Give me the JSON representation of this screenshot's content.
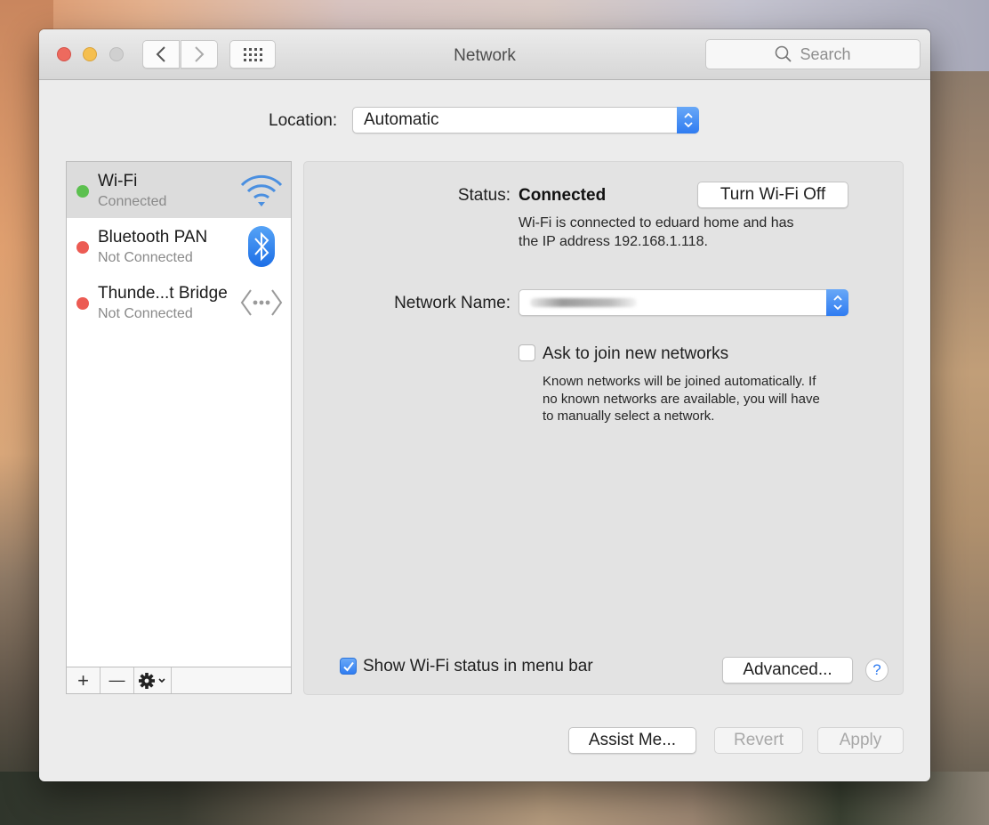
{
  "window": {
    "title": "Network",
    "search": {
      "placeholder": "Search",
      "icon": "magnifier-icon"
    },
    "toolbar": {
      "back_icon": "chevron-left-icon",
      "forward_icon": "chevron-right-icon",
      "show_all_icon": "grid-icon"
    }
  },
  "location": {
    "label": "Location:",
    "value": "Automatic"
  },
  "services": [
    {
      "name": "Wi-Fi",
      "status": "Connected",
      "status_color": "#5cc04f",
      "icon": "wifi-icon",
      "selected": true
    },
    {
      "name": "Bluetooth PAN",
      "status": "Not Connected",
      "status_color": "#ec5b53",
      "icon": "bluetooth-icon",
      "selected": false
    },
    {
      "name": "Thunde...t Bridge",
      "status": "Not Connected",
      "status_color": "#ec5b53",
      "icon": "thunderbolt-bridge-icon",
      "selected": false
    }
  ],
  "sidebar_toolbar": {
    "add": "+",
    "remove": "—",
    "action_icon": "gear-icon"
  },
  "detail": {
    "status_label": "Status:",
    "status_value": "Connected",
    "turn_off_button": "Turn Wi-Fi Off",
    "status_desc_line1": "Wi-Fi is connected to eduard home and has",
    "status_desc_line2": "the IP address 192.168.1.118.",
    "network_name_label": "Network Name:",
    "network_name_value": "",
    "ask_join_label": "Ask to join new networks",
    "ask_join_checked": false,
    "ask_join_desc_line1": "Known networks will be joined automatically. If",
    "ask_join_desc_line2": "no known networks are available, you will have",
    "ask_join_desc_line3": "to manually select a network.",
    "show_status_label": "Show Wi-Fi status in menu bar",
    "show_status_checked": true,
    "advanced_button": "Advanced...",
    "help_button": "?"
  },
  "footer": {
    "assist_button": "Assist Me...",
    "revert_button": "Revert",
    "apply_button": "Apply"
  }
}
